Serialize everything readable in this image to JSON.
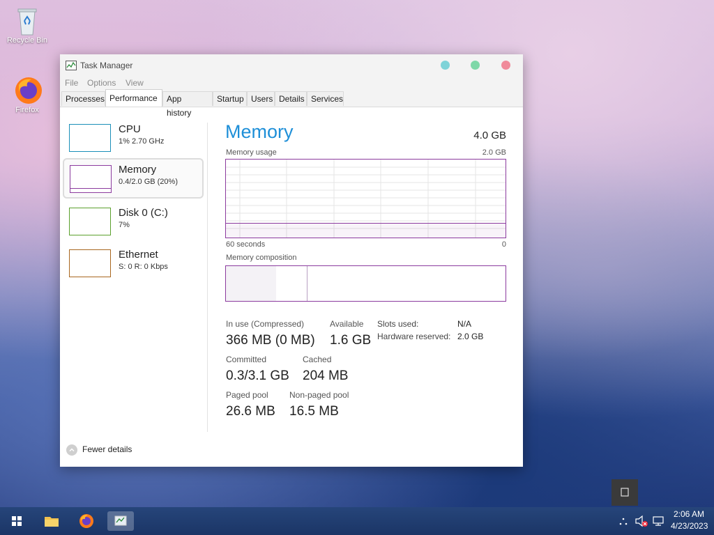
{
  "desktop": {
    "icons": [
      {
        "label": "Recycle Bin",
        "icon": "recycle-bin-icon"
      },
      {
        "label": "Firefox",
        "icon": "firefox-icon"
      }
    ]
  },
  "window": {
    "title": "Task Manager",
    "menu": [
      "File",
      "Options",
      "View"
    ],
    "tabs": [
      "Processes",
      "Performance",
      "App history",
      "Startup",
      "Users",
      "Details",
      "Services"
    ],
    "active_tab": "Performance",
    "controls": {
      "minimize_color": "#7fd3d8",
      "maximize_color": "#7fd8a8",
      "close_color": "#f08a9a"
    }
  },
  "sidebar": {
    "items": [
      {
        "name": "CPU",
        "sub": "1% 2.70 GHz",
        "color": "#1a8fb8"
      },
      {
        "name": "Memory",
        "sub": "0.4/2.0 GB (20%)",
        "color": "#8b3a9e"
      },
      {
        "name": "Disk 0 (C:)",
        "sub": "7%",
        "color": "#5aa02c"
      },
      {
        "name": "Ethernet",
        "sub": "S: 0 R: 0 Kbps",
        "color": "#a8661e"
      }
    ]
  },
  "memory": {
    "title": "Memory",
    "total": "4.0 GB",
    "usage_label": "Memory usage",
    "usage_max": "2.0 GB",
    "axis_left": "60 seconds",
    "axis_right": "0",
    "usage_level": 0.18,
    "composition_label": "Memory composition",
    "composition": {
      "in_use": 0.18,
      "modified": 0.01,
      "standby": 0.1
    },
    "stats": {
      "in_use_label": "In use (Compressed)",
      "in_use_value": "366 MB (0 MB)",
      "available_label": "Available",
      "available_value": "1.6 GB",
      "committed_label": "Committed",
      "committed_value": "0.3/3.1 GB",
      "cached_label": "Cached",
      "cached_value": "204 MB",
      "paged_label": "Paged pool",
      "paged_value": "26.6 MB",
      "nonpaged_label": "Non-paged pool",
      "nonpaged_value": "16.5 MB",
      "slots_label": "Slots used:",
      "slots_value": "N/A",
      "hw_label": "Hardware reserved:",
      "hw_value": "2.0 GB"
    },
    "fewer_details": "Fewer details"
  },
  "taskbar": {
    "time": "2:06 AM",
    "date": "4/23/2023"
  }
}
